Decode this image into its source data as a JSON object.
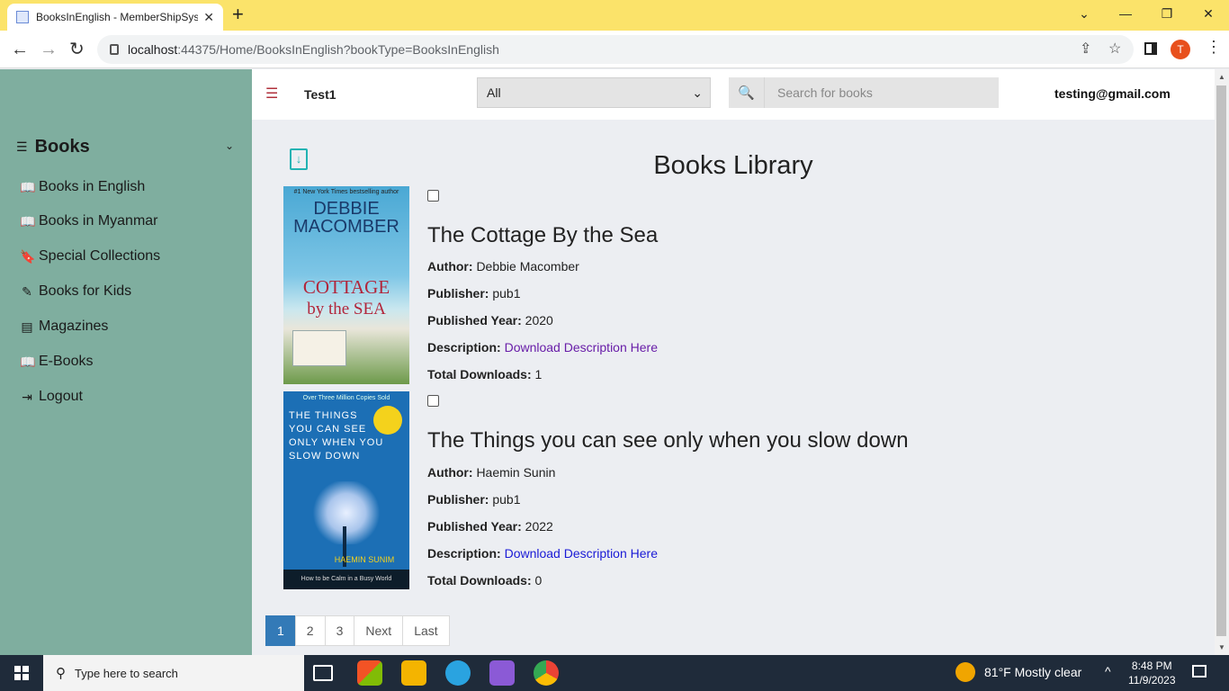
{
  "browser": {
    "tab_title": "BooksInEnglish - MemberShipSyste",
    "url_host": "localhost",
    "url_path": ":44375/Home/BooksInEnglish?bookType=BooksInEnglish",
    "avatar_letter": "T"
  },
  "sidebar": {
    "heading": "Books",
    "items": [
      {
        "label": "Books in English",
        "icon": "book-open-icon"
      },
      {
        "label": "Books in Myanmar",
        "icon": "book-open-icon"
      },
      {
        "label": "Special Collections",
        "icon": "bookmark-icon"
      },
      {
        "label": "Books for Kids",
        "icon": "pencil-icon"
      },
      {
        "label": "Magazines",
        "icon": "newspaper-icon"
      },
      {
        "label": "E-Books",
        "icon": "book-open-icon"
      },
      {
        "label": "Logout",
        "icon": "logout-icon"
      }
    ]
  },
  "header": {
    "brand": "Test1",
    "filter_selected": "All",
    "search_placeholder": "Search for books",
    "user_email": "testing@gmail.com"
  },
  "main": {
    "title": "Books Library",
    "books": [
      {
        "title": "The Cottage By the Sea",
        "author_label": "Author:",
        "author": "Debbie Macomber",
        "publisher_label": "Publisher:",
        "publisher": "pub1",
        "year_label": "Published Year:",
        "year": "2020",
        "desc_label": "Description:",
        "desc_link": "Download Description Here",
        "downloads_label": "Total Downloads:",
        "downloads": "1",
        "cover": {
          "line1": "DEBBIE",
          "line2": "MACOMBER",
          "line3": "COTTAGE",
          "line4": "by the SEA",
          "tag": "#1 New York Times bestselling author"
        }
      },
      {
        "title": "The Things you can see only when you slow down",
        "author_label": "Author:",
        "author": "Haemin Sunin",
        "publisher_label": "Publisher:",
        "publisher": "pub1",
        "year_label": "Published Year:",
        "year": "2022",
        "desc_label": "Description:",
        "desc_link": "Download Description Here",
        "downloads_label": "Total Downloads:",
        "downloads": "0",
        "cover": {
          "line1": "THE THINGS",
          "line2": "YOU CAN SEE",
          "line3": "ONLY WHEN YOU",
          "line4": "SLOW DOWN",
          "author": "HAEMIN SUNIM",
          "tag": "Over Three Million Copies Sold",
          "subtitle": "How to be Calm in a Busy World"
        }
      }
    ]
  },
  "pagination": [
    "1",
    "2",
    "3",
    "Next",
    "Last"
  ],
  "taskbar": {
    "search_placeholder": "Type here to search",
    "weather": "81°F  Mostly clear",
    "time": "8:48 PM",
    "date": "11/9/2023"
  }
}
